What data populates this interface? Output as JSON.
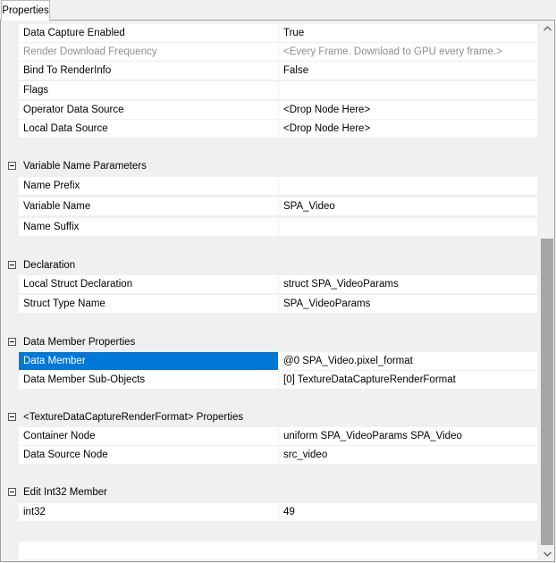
{
  "tab": {
    "label": "Properties"
  },
  "properties": {
    "data_capture_enabled": {
      "name": "Data Capture Enabled",
      "value": "True"
    },
    "render_download_frequency": {
      "name": "Render Download Frequency",
      "value": "<Every Frame. Download to GPU every frame.>"
    },
    "bind_to_renderinfo": {
      "name": "Bind To RenderInfo",
      "value": "False"
    },
    "flags": {
      "name": "Flags",
      "value": ""
    },
    "operator_data_source": {
      "name": "Operator Data Source",
      "value": "<Drop Node Here>"
    },
    "local_data_source": {
      "name": "Local Data Source",
      "value": "<Drop Node Here>"
    }
  },
  "categories": {
    "variable_name_parameters": {
      "label": "Variable Name Parameters",
      "rows": {
        "name_prefix": {
          "name": "Name Prefix",
          "value": ""
        },
        "variable_name": {
          "name": "Variable Name",
          "value": "SPA_Video"
        },
        "name_suffix": {
          "name": "Name Suffix",
          "value": ""
        }
      }
    },
    "declaration": {
      "label": "Declaration",
      "rows": {
        "local_struct_declaration": {
          "name": "Local Struct Declaration",
          "value": "struct SPA_VideoParams"
        },
        "struct_type_name": {
          "name": "Struct Type Name",
          "value": "SPA_VideoParams"
        }
      }
    },
    "data_member_properties": {
      "label": "Data Member Properties",
      "rows": {
        "data_member": {
          "name": "Data Member",
          "value": "@0 SPA_Video.pixel_format"
        },
        "data_member_sub_objects": {
          "name": "Data Member Sub-Objects",
          "value": "[0] TextureDataCaptureRenderFormat"
        }
      }
    },
    "texture_properties": {
      "label": "<TextureDataCaptureRenderFormat> Properties",
      "rows": {
        "container_node": {
          "name": "Container Node",
          "value": "uniform SPA_VideoParams SPA_Video"
        },
        "data_source_node": {
          "name": "Data Source Node",
          "value": "src_video"
        }
      }
    },
    "edit_int32_member": {
      "label": "Edit Int32 Member",
      "rows": {
        "int32": {
          "name": "int32",
          "value": "49"
        }
      }
    }
  },
  "scrollbar": {
    "up_icon": "chevron-up-icon",
    "down_icon": "chevron-down-icon"
  },
  "colors": {
    "selection": "#0078d7",
    "disabled_text": "#8e8e8e",
    "background": "#f0f0f0"
  }
}
